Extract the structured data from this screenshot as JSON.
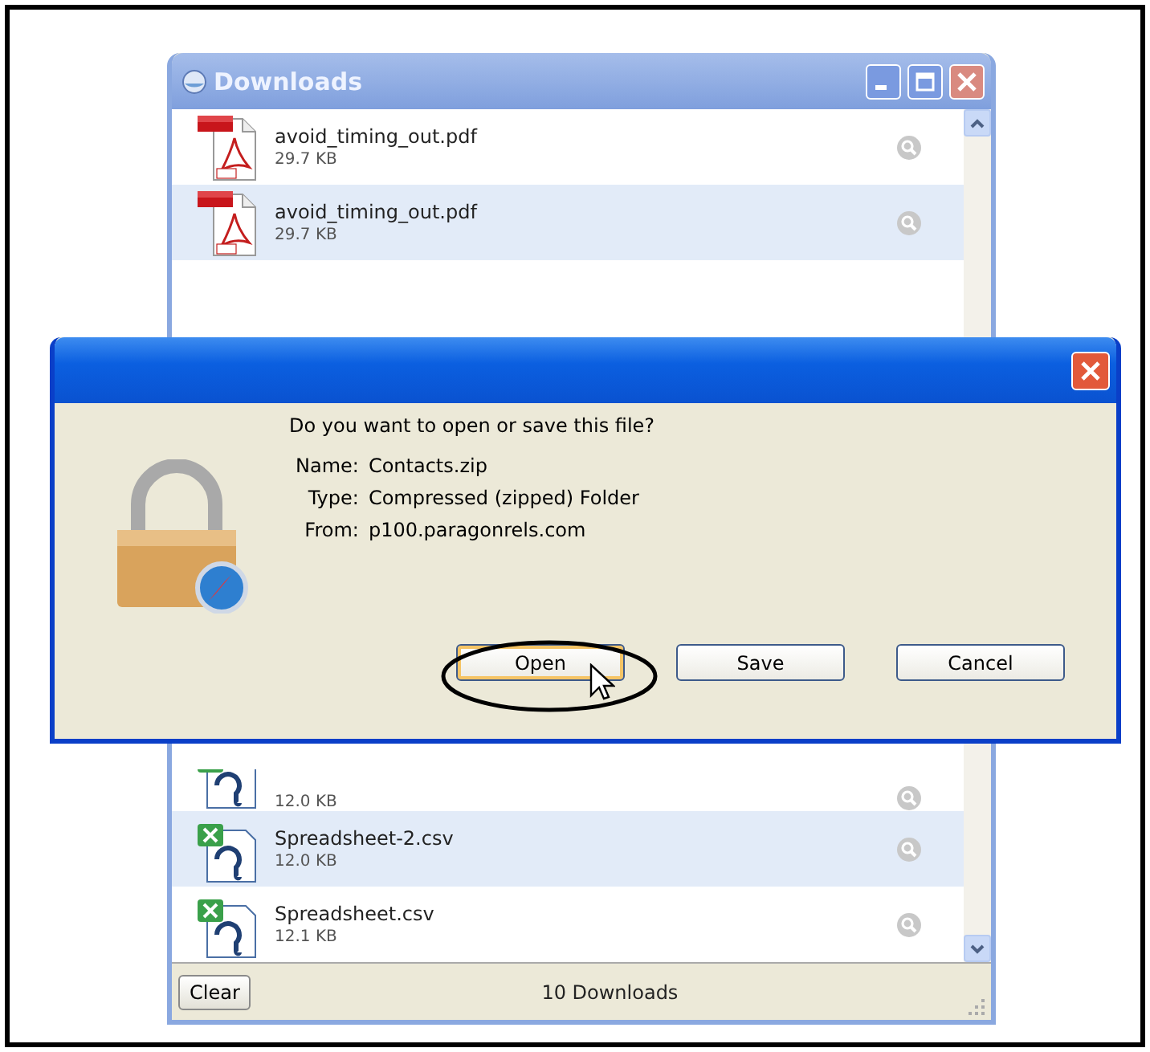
{
  "downloads_window": {
    "title": "Downloads",
    "files": [
      {
        "name": "avoid_timing_out.pdf",
        "size": "29.7 KB",
        "kind": "pdf",
        "shaded": false
      },
      {
        "name": "avoid_timing_out.pdf",
        "size": "29.7 KB",
        "kind": "pdf",
        "shaded": true
      },
      {
        "size": "12.0 KB",
        "kind": "csv",
        "shaded": false
      },
      {
        "name": "Spreadsheet-2.csv",
        "size": "12.0 KB",
        "kind": "csv",
        "shaded": true
      },
      {
        "name": "Spreadsheet.csv",
        "size": "12.1 KB",
        "kind": "csv",
        "shaded": false
      }
    ],
    "clear_button": "Clear",
    "status": "10 Downloads"
  },
  "dialog": {
    "question": "Do you want to open or save this file?",
    "details": [
      {
        "label": "Name:",
        "value": "Contacts.zip"
      },
      {
        "label": "Type:",
        "value": "Compressed (zipped) Folder"
      },
      {
        "label": "From:",
        "value": "p100.paragonrels.com"
      }
    ],
    "buttons": [
      {
        "label": "Open",
        "default": true
      },
      {
        "label": "Save",
        "default": false
      },
      {
        "label": "Cancel",
        "default": false
      }
    ]
  }
}
